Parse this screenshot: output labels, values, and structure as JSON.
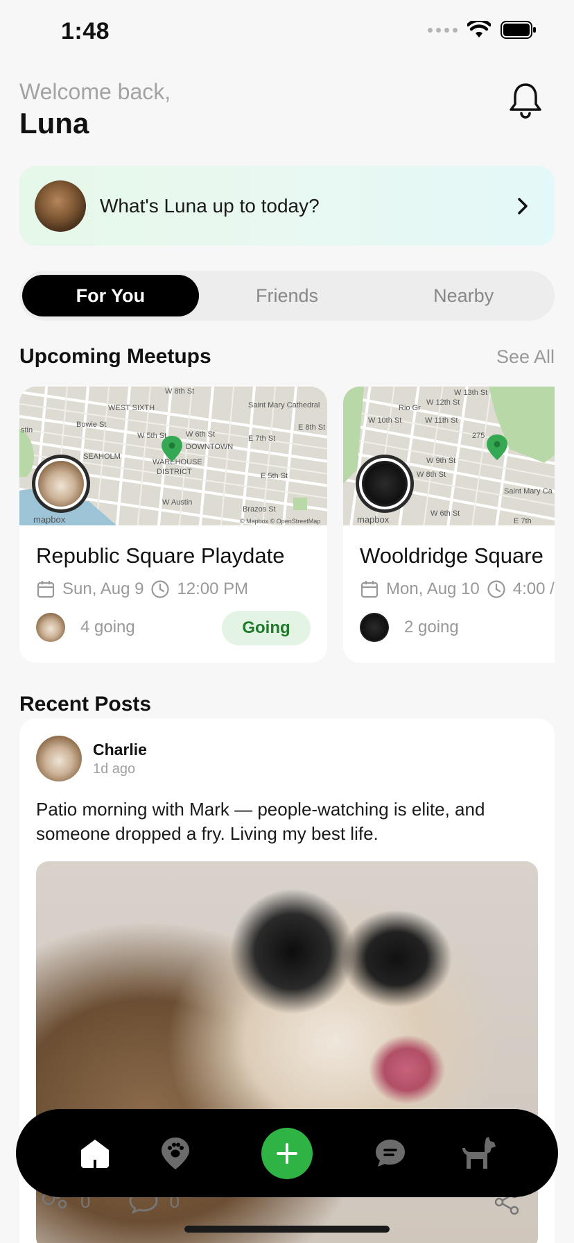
{
  "status_bar": {
    "time": "1:48"
  },
  "header": {
    "welcome": "Welcome back,",
    "name": "Luna"
  },
  "prompt": {
    "text": "What's Luna up to today?"
  },
  "tabs": [
    {
      "label": "For You",
      "active": true
    },
    {
      "label": "Friends",
      "active": false
    },
    {
      "label": "Nearby",
      "active": false
    }
  ],
  "meetups": {
    "title": "Upcoming Meetups",
    "see_all": "See All",
    "cards": [
      {
        "title": "Republic Square Playdate",
        "date": "Sun, Aug 9",
        "time": "12:00 PM",
        "going_count": "4 going",
        "status": "Going",
        "map_labels": [
          "WEST SIXTH",
          "W 5th St",
          "W 6th St",
          "E 7th St",
          "E 8th St",
          "DOWNTOWN",
          "WAREHOUSE",
          "DISTRICT",
          "E 5th St",
          "W Austin",
          "SEAHOLM",
          "Saint Mary Cathedral",
          "Bowie St",
          "Brazos St",
          "W 8th St",
          "stin",
          "mapbox",
          "© Mapbox © OpenStreetMap"
        ]
      },
      {
        "title": "Wooldridge Square",
        "date": "Mon, Aug 10",
        "time": "4:00 /",
        "going_count": "2 going",
        "status": "",
        "map_labels": [
          "W 12th St",
          "W 13th St",
          "W 10th St",
          "W 11th St",
          "275",
          "W 9th St",
          "W 8th St",
          "W 6th St",
          "Saint Mary Ca",
          "Rio Gr",
          "mapbox",
          "E 7th"
        ]
      }
    ]
  },
  "recent_posts": {
    "title": "Recent Posts",
    "post": {
      "author": "Charlie",
      "time": "1d ago",
      "text": "Patio morning with Mark — people-watching is elite, and someone dropped a fry. Living my best life.",
      "likes": "0",
      "comments": "0"
    }
  },
  "colors": {
    "accent": "#2fb344",
    "going_bg": "#e3f4e4",
    "going_text": "#1f7a2c",
    "tabbar": "#000000"
  },
  "icons": [
    "bell-icon",
    "chevron-right-icon",
    "calendar-icon",
    "clock-icon",
    "home-icon",
    "paw-icon",
    "plus-icon",
    "chat-icon",
    "dog-icon",
    "like-icon",
    "comment-icon",
    "share-icon",
    "map-pin-icon"
  ]
}
